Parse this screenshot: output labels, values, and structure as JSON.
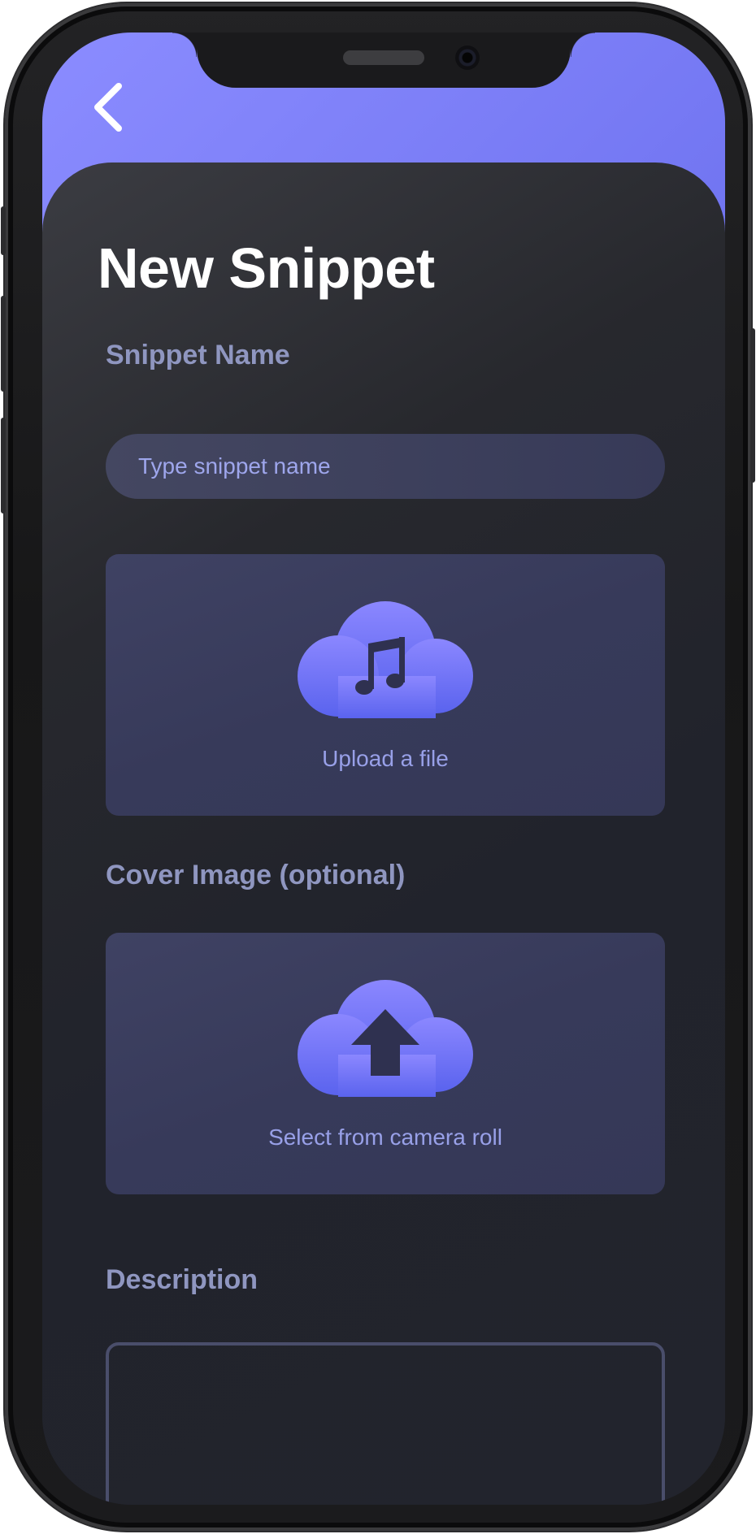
{
  "page": {
    "title": "New Snippet"
  },
  "snippet_name": {
    "label": "Snippet Name",
    "placeholder": "Type snippet name",
    "value": ""
  },
  "file_upload": {
    "icon": "music-cloud-icon",
    "caption": "Upload a file"
  },
  "cover_image": {
    "label": "Cover Image (optional)",
    "icon": "upload-cloud-icon",
    "caption": "Select from camera roll"
  },
  "description": {
    "label": "Description",
    "value": ""
  },
  "navigation": {
    "back_icon": "chevron-left-icon"
  },
  "colors": {
    "accent": "#7c7ff8",
    "card_bg": "#21232c",
    "label": "#8f96c0",
    "upload_box": "#383b5a"
  }
}
